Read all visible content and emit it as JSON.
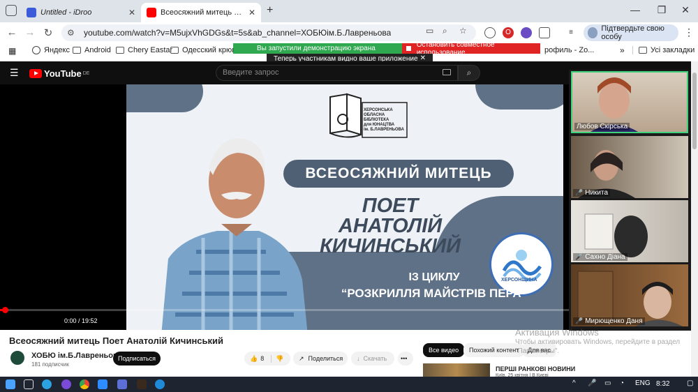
{
  "browser": {
    "tabs": [
      {
        "title": "Untitled - iDroo",
        "active": false,
        "icon": "idroo-icon"
      },
      {
        "title": "Всеосяжний митець Поет Анатолій Кичинський",
        "active": true,
        "icon": "youtube-icon"
      }
    ],
    "new_tab": "+",
    "url": "youtube.com/watch?v=M5ujxVhGDGs&t=5s&ab_channel=ХОБЮім.Б.Лавреньова",
    "profile_button": "Підтвердьте свою особу",
    "window_controls": {
      "minimize": "—",
      "restore": "❐",
      "close": "✕"
    }
  },
  "bookmarks": {
    "items": [
      "Яндекс",
      "Android",
      "Chery Eastar",
      "Одесский крюинг",
      "рофиль - Zo..."
    ],
    "more": "»",
    "all_bookmarks": "Усі закладки"
  },
  "zoom_banner": {
    "sharing_label": "Вы запустили демонстрацию экрана",
    "stop_label": "Остановить совместное использование",
    "note": "Теперь участникам видно ваше приложение",
    "note_close": "✕"
  },
  "youtube": {
    "logo": "YouTube",
    "logo_region": "DE",
    "search_placeholder": "Введите запрос",
    "video": {
      "library_lines": [
        "ХЕРСОНСЬКА",
        "ОБЛАСНА",
        "БІБЛІОТЕКА",
        "для ЮНАЦТВА",
        "ім. Б.ЛАВРЕНЬОВА"
      ],
      "headline": "ВСЕОСЯЖНИЙ МИТЕЦЬ",
      "poet_lines": [
        "ПОЕТ",
        "АНАТОЛІЙ",
        "КИЧИНСЬКИЙ"
      ],
      "series_line1": "ІЗ ЦИКЛУ",
      "series_line2": "“РОЗКРИЛЛЯ МАЙСТРІВ ПЕРА”",
      "emblem_text": "ХЕРСОНЩИНА"
    },
    "player": {
      "time": "0:00 / 19:52",
      "progress": 0.005
    },
    "title": "Всеосяжний митець Поет Анатолій Кичинський",
    "channel": "ХОБЮ ім.Б.Лавреньова",
    "subscribers": "181 подписчик",
    "subscribe": "Подписаться",
    "likes": "8",
    "share": "Поделиться",
    "download": "Скачать",
    "more": "•••",
    "chips": [
      "Все видео",
      "Похожий контент",
      "Для вас"
    ],
    "recommended": {
      "title": "ПЕРШІ РАНКОВІ НОВИНИ",
      "subtitle": "Київ, 25 квітня | В Києві"
    }
  },
  "zoom_participants": [
    {
      "name": "Любов Скірська",
      "muted": false
    },
    {
      "name": "Никита",
      "muted": true
    },
    {
      "name": "Сахно Діана",
      "muted": true
    },
    {
      "name": "Мирющенко Даня",
      "muted": true
    }
  ],
  "windows_watermark": {
    "heading": "Активация Windows",
    "text": "Чтобы активировать Windows, перейдите в раздел \"Параметры\"."
  },
  "taskbar": {
    "language": "ENG",
    "time": "8:32"
  },
  "colors": {
    "youtube_red": "#ff0000",
    "zoom_green": "#2fa84f",
    "zoom_red": "#e02424",
    "active_speaker": "#3fd27a"
  }
}
